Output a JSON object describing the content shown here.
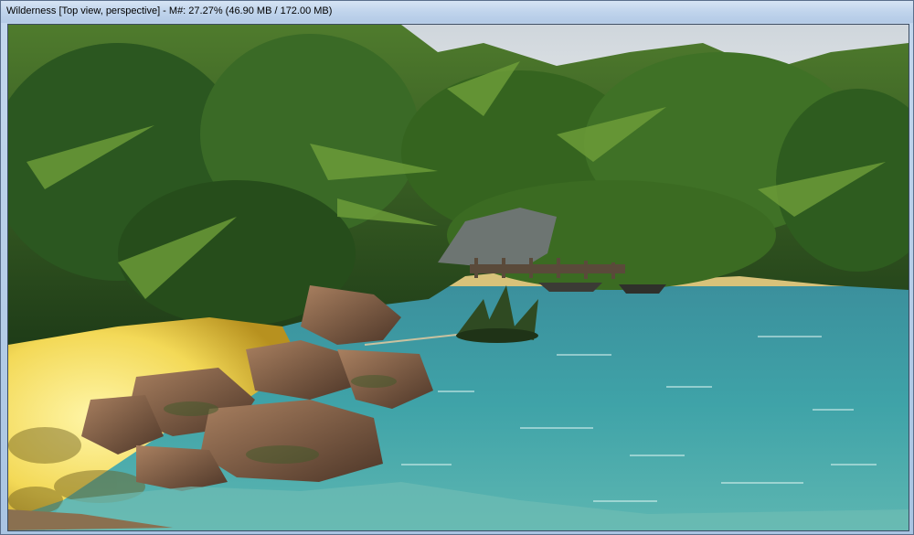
{
  "window": {
    "title": "Wilderness [Top view, perspective] - M#: 27.27% (46.90 MB / 172.00 MB)"
  },
  "viewport": {
    "scene": "3d-render-tropical-lagoon",
    "colors": {
      "sky": "#d7dde2",
      "water": "#3f9fa6",
      "sand": "#f3e06a",
      "foliage": "#2e5a22",
      "rock": "#7a5a44"
    }
  }
}
